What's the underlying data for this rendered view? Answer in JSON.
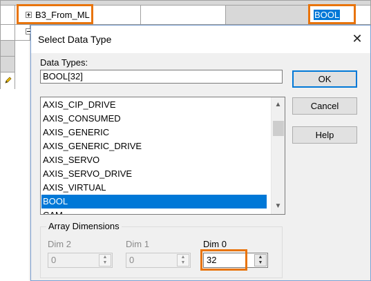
{
  "background": {
    "row_label": "B3_From_ML",
    "row_type_value": "BOOL"
  },
  "dialog": {
    "title": "Select Data Type",
    "data_types_label": "Data Types:",
    "data_type_value": "BOOL[32]",
    "buttons": {
      "ok": "OK",
      "cancel": "Cancel",
      "help": "Help"
    },
    "list_items": [
      "AXIS_CIP_DRIVE",
      "AXIS_CONSUMED",
      "AXIS_GENERIC",
      "AXIS_GENERIC_DRIVE",
      "AXIS_SERVO",
      "AXIS_SERVO_DRIVE",
      "AXIS_VIRTUAL",
      "BOOL",
      "CAM"
    ],
    "selected_item": "BOOL",
    "array_dimensions": {
      "group_label": "Array Dimensions",
      "dim2_label": "Dim 2",
      "dim2_value": "0",
      "dim1_label": "Dim 1",
      "dim1_value": "0",
      "dim0_label": "Dim 0",
      "dim0_value": "32"
    }
  },
  "colors": {
    "highlight": "#e8740c",
    "selection": "#0078d7"
  }
}
